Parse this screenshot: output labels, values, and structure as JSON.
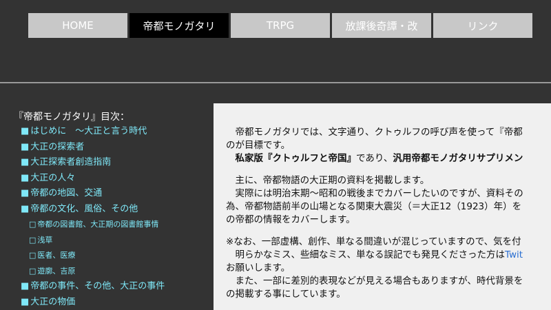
{
  "nav": {
    "tabs": [
      {
        "label": "HOME",
        "active": false
      },
      {
        "label": "帝都モノガタリ",
        "active": true
      },
      {
        "label": "TRPG",
        "active": false
      },
      {
        "label": "放課後奇譚・改",
        "active": false
      },
      {
        "label": "リンク",
        "active": false
      }
    ]
  },
  "sidebar": {
    "title": "『帝都モノガタリ』目次：",
    "items": [
      {
        "label": "はじめに　～大正と言う時代",
        "bullet": "■"
      },
      {
        "label": "大正の探索者",
        "bullet": "■"
      },
      {
        "label": "大正探索者創造指南",
        "bullet": "■"
      },
      {
        "label": "大正の人々",
        "bullet": "■"
      },
      {
        "label": "帝都の地図、交通",
        "bullet": "■"
      },
      {
        "label": "帝都の文化、風俗、その他",
        "bullet": "■"
      },
      {
        "label": "帝都の図書館、大正期の図書館事情",
        "bullet": "□"
      },
      {
        "label": "浅草",
        "bullet": "□"
      },
      {
        "label": "医者、医療",
        "bullet": "□"
      },
      {
        "label": "遊廓、吉原",
        "bullet": "□"
      },
      {
        "label": "帝都の事件、その他、大正の事件",
        "bullet": "■"
      },
      {
        "label": "大正の物価",
        "bullet": "■"
      }
    ]
  },
  "main": {
    "p1_l1": "　帝都モノガタリでは、文字通り、クトゥルフの呼び声を使って『帝都",
    "p1_l2": "のが目標です。",
    "p1_l3a": "　",
    "p1_l3b": "私家版『クトゥルフと帝国』",
    "p1_l3c": "であり、",
    "p1_l3d": "汎用帝都モノガタリサプリメン",
    "p2_l1": "　主に、帝都物語の大正期の資料を掲載します。",
    "p2_l2": "　実際には明治末期～昭和の戦後までカバーしたいのですが、資料その",
    "p2_l3": "為、帝都物語前半の山場となる関東大震災（＝大正12（1923）年）を",
    "p2_l4": "の帝都の情報をカバーします。",
    "p3_l1": "※なお、一部虚構、創作、単なる間違いが混じっていますので、気を付",
    "p3_l2a": "　明らかなミス、些細なミス、単なる誤記でも発見くださった方は",
    "p3_l2b": "Twit",
    "p3_l3": "お願いします。",
    "p3_l4": "　また、一部に差別的表現などが見える場合もありますが、時代背景を",
    "p3_l5": "の掲載する事にしています。"
  }
}
